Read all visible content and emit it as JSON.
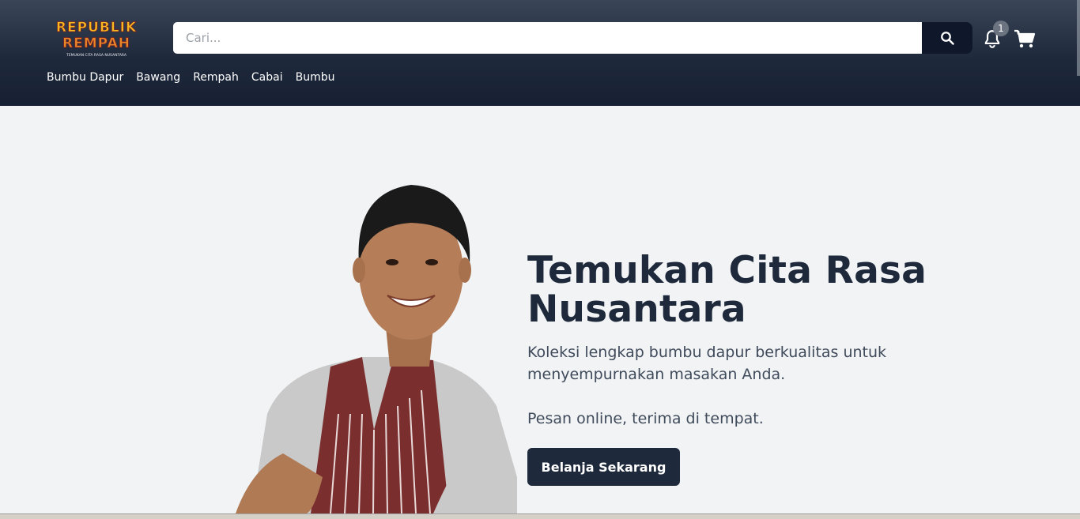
{
  "header": {
    "logo": {
      "line1": "REPUBLIK",
      "line2": "REMPAH",
      "tagline": "TEMUKAN CITA RASA NUSANTARA"
    },
    "search": {
      "placeholder": "Cari..."
    },
    "notifications": {
      "count": "1"
    },
    "icons": {
      "search": "search-icon",
      "bell": "bell-icon",
      "cart": "cart-icon"
    }
  },
  "nav": {
    "items": [
      "Bumbu Dapur",
      "Bawang",
      "Rempah",
      "Cabai",
      "Bumbu"
    ]
  },
  "hero": {
    "title": "Temukan Cita Rasa Nusantara",
    "description": "Koleksi lengkap bumbu dapur berkualitas untuk menyempurnakan masakan Anda.",
    "subtext": "Pesan online, terima di tempat.",
    "cta_label": "Belanja Sekarang"
  },
  "colors": {
    "header_bg": "#1e293b",
    "accent": "#0f172a",
    "page_bg": "#f1f3f5",
    "title": "#1e293b"
  }
}
